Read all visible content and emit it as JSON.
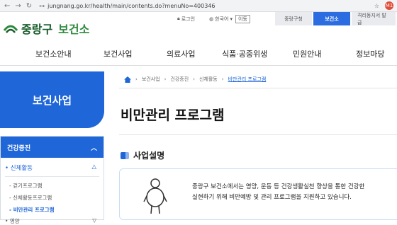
{
  "browser": {
    "url": "jungnang.go.kr/health/main/contents.do?menuNo=400346",
    "extension_badge": "M1"
  },
  "site": {
    "logo_main": "중랑구",
    "logo_sub": "보건소"
  },
  "util": {
    "login": "로그인",
    "lang": "한국어",
    "go": "이동"
  },
  "toptabs": [
    "중랑구청",
    "보건소",
    "격리동지서 발급"
  ],
  "mainnav": [
    "보건소안내",
    "보건사업",
    "의료사업",
    "식품·공중위생",
    "민원안내",
    "정보마당"
  ],
  "sidebar": {
    "title": "보건사업",
    "section": "건강증진",
    "sub_label": "신체활동",
    "items": [
      "걷기프로그램",
      "신체활동프로그램",
      "비만관리 프로그램"
    ],
    "more": "영양"
  },
  "breadcrumb": [
    "보건사업",
    "건강증진",
    "신체활동",
    "비만관리 프로그램"
  ],
  "page": {
    "title": "비만관리 프로그램",
    "section_title": "사업설명",
    "description_line1": "중랑구 보건소에서는 영양, 운동 등 건강생활실천 향상을 통한 건강한",
    "description_line2": "실현하기 위해 비만예방 및 관리 프로그램을 지원하고 있습니다."
  },
  "colors": {
    "accent": "#1f66d8",
    "brand_green": "#2c8a3c"
  }
}
